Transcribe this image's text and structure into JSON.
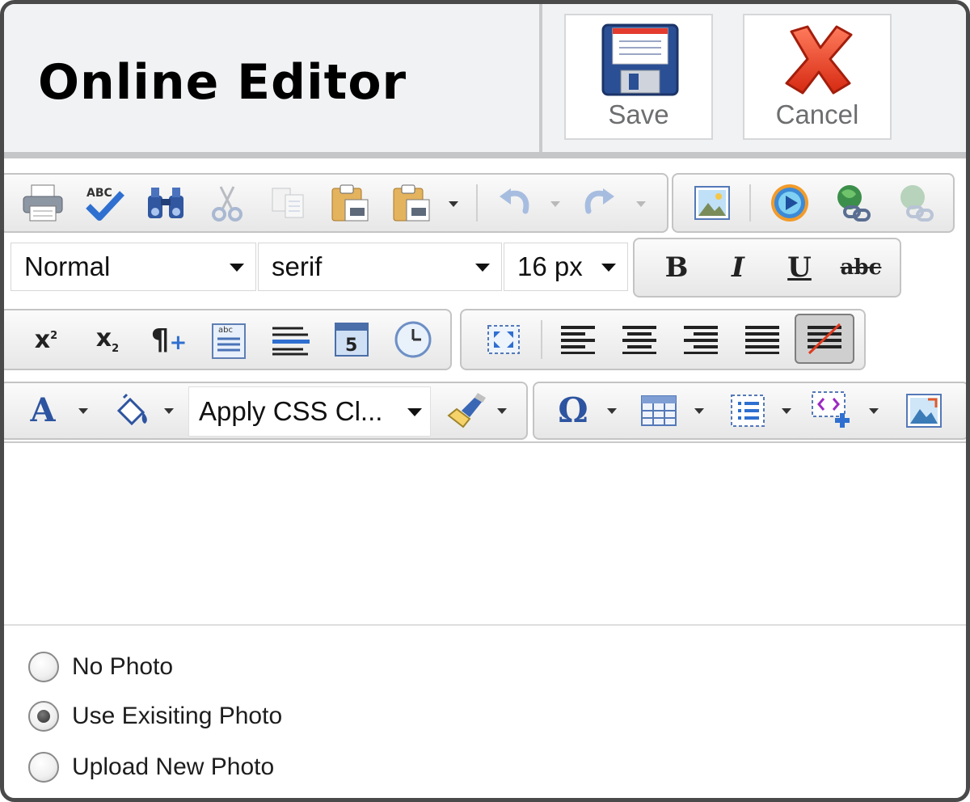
{
  "header": {
    "title": "Online Editor",
    "save_label": "Save",
    "cancel_label": "Cancel"
  },
  "toolbar": {
    "row1": [
      "print-icon",
      "spellcheck-icon",
      "find-icon",
      "cut-icon",
      "copy-icon",
      "paste-icon",
      "paste-special-icon",
      "undo-icon",
      "redo-icon",
      "image-icon",
      "media-icon",
      "link-icon",
      "unlink-icon"
    ],
    "format_select": "Normal",
    "font_select": "serif",
    "size_select": "16 px",
    "row2_buttons": [
      "bold-icon",
      "italic-icon",
      "underline-icon",
      "strikethrough-icon"
    ],
    "row3_buttons": [
      "superscript-icon",
      "subscript-icon",
      "paragraph-icon",
      "template-icon",
      "insert-rule-icon",
      "date-icon",
      "time-icon",
      "select-all-icon",
      "align-left-icon",
      "align-center-icon",
      "align-right-icon",
      "justify-icon",
      "remove-format-icon"
    ],
    "css_class_select": "Apply CSS Cl...",
    "row4_buttons": [
      "font-color-icon",
      "highlight-color-icon",
      "format-painter-icon",
      "special-char-icon",
      "table-icon",
      "list-icon",
      "insert-snippet-icon",
      "image-manager-icon"
    ],
    "glyphs": {
      "superscript": "x",
      "superscript_exp": "2",
      "subscript": "x",
      "subscript_exp": "2",
      "paragraph": "¶",
      "bold": "B",
      "italic": "I",
      "underline": "U",
      "strike": "abc",
      "spell": "ABC",
      "template_small": "abc",
      "date_num": "5",
      "font_color": "A",
      "omega": "Ω"
    }
  },
  "photo_options": {
    "options": [
      {
        "label": "No Photo",
        "checked": false
      },
      {
        "label": "Use Exisiting Photo",
        "checked": true
      },
      {
        "label": "Upload New Photo",
        "checked": false
      }
    ]
  },
  "colors": {
    "header_bg": "#f1f2f4",
    "frame_border": "#4a4a4a",
    "save_blue": "#2b4f94",
    "cancel_red": "#e03a1e"
  }
}
